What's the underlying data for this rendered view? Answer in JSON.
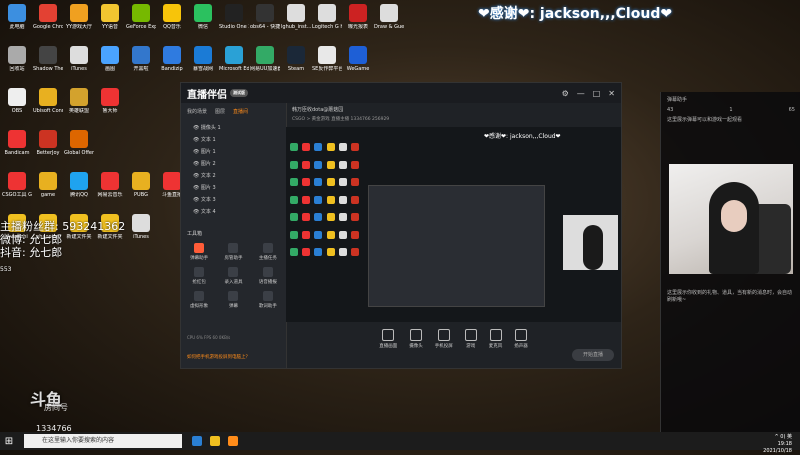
{
  "top_banner": "❤感谢❤: jackson,,,Cloud❤",
  "desktop": {
    "icons": [
      {
        "label": "此电脑",
        "color": "#3c8fe0"
      },
      {
        "label": "Google Chrome",
        "color": "#e34133"
      },
      {
        "label": "YY游戏大厅",
        "color": "#f0a020"
      },
      {
        "label": "YY语音",
        "color": "#f2c530"
      },
      {
        "label": "GeForce Experience",
        "color": "#76b900"
      },
      {
        "label": "QQ音乐",
        "color": "#f7c40a"
      },
      {
        "label": "微信",
        "color": "#2bc15f"
      },
      {
        "label": "Studio One 3",
        "color": "#222"
      },
      {
        "label": "obs64 - 快捷方式",
        "color": "#333"
      },
      {
        "label": "lghub_inst...",
        "color": "#ddd"
      },
      {
        "label": "Logitech G HUB",
        "color": "#ddd"
      },
      {
        "label": "曝光报表",
        "color": "#c22"
      },
      {
        "label": "Draw & Guess",
        "color": "#ddd"
      },
      {
        "label": "回收站",
        "color": "#aaa"
      },
      {
        "label": "Shadow The Wine Sour...",
        "color": "#444"
      },
      {
        "label": "iTunes",
        "color": "#ddd"
      },
      {
        "label": "画图",
        "color": "#4aa3ff"
      },
      {
        "label": "开黑啦",
        "color": "#37c"
      },
      {
        "label": "Bandizip",
        "color": "#2f7be0"
      },
      {
        "label": "暴雪战网",
        "color": "#1b7bd6"
      },
      {
        "label": "Microsoft Edge",
        "color": "#2aa1d6"
      },
      {
        "label": "网易UU加速器",
        "color": "#3a6"
      },
      {
        "label": "Steam",
        "color": "#1b2838"
      },
      {
        "label": "SE反作弊平台",
        "color": "#e8e8e8"
      },
      {
        "label": "WeGame",
        "color": "#1e5fd6"
      },
      {
        "label": "OBS",
        "color": "#eee"
      },
      {
        "label": "Ubisoft Connect",
        "color": "#e8b020"
      },
      {
        "label": "英雄联盟",
        "color": "#d3a22d"
      },
      {
        "label": "鲁大师",
        "color": "#e33"
      },
      {
        "label": "Bandicam",
        "color": "#e33"
      },
      {
        "label": "BetterJoy",
        "color": "#c32"
      },
      {
        "label": "Global Offensive",
        "color": "#d60"
      },
      {
        "label": "CSGO工具 Gamemode",
        "color": "#e33"
      },
      {
        "label": "game",
        "color": "#e8b020"
      },
      {
        "label": "腾讯QQ",
        "color": "#1fa3ef"
      },
      {
        "label": "网易云音乐",
        "color": "#e33"
      },
      {
        "label": "PUBG",
        "color": "#e8b020"
      },
      {
        "label": "斗鱼直播",
        "color": "#e33"
      },
      {
        "label": "wwenzhi",
        "color": "#f0c020"
      },
      {
        "label": "shaopian",
        "color": "#f0c020"
      },
      {
        "label": "新建文件夹",
        "color": "#f0c020"
      },
      {
        "label": "新建文件夹",
        "color": "#f0c020"
      },
      {
        "label": "iTunes",
        "color": "#ddd"
      }
    ]
  },
  "overlay": {
    "fan_group": "主播粉丝群: 593241362",
    "weibo": "微博: 允七郎",
    "douyin": "抖音: 允七郎",
    "count": "553"
  },
  "douyu_logo": {
    "brand": "斗鱼",
    "sub": "房间号",
    "room_id": "1334766"
  },
  "app": {
    "name": "直播伴侣",
    "version_badge": "测试版",
    "sidebar_tabs": [
      "我的场景",
      "图层",
      "直播间"
    ],
    "scenes": [
      "摄像头 1",
      "文本 1",
      "图片 1",
      "图片 2",
      "文本 2",
      "图片 3",
      "文本 3",
      "文本 4"
    ],
    "tools_title": "工具箱",
    "tools": [
      {
        "label": "弹幕助手",
        "hl": true
      },
      {
        "label": "房管助手",
        "hl": false
      },
      {
        "label": "主播任务",
        "hl": false
      },
      {
        "label": "抢红包",
        "hl": false
      },
      {
        "label": "录入道具",
        "hl": false
      },
      {
        "label": "语音播报",
        "hl": false
      },
      {
        "label": "虚拟形象",
        "hl": false
      },
      {
        "label": "弹幕",
        "hl": false
      },
      {
        "label": "歌词助手",
        "hl": false
      }
    ],
    "sidebar_footer": "如何把手机游戏投屏到电脑上？",
    "room_title": "韩万臣收dota@蘑菇园",
    "room_meta": "CSGO > 黄金游戏    直播主播    1334766    256929",
    "preview_banner": "❤感谢❤: jackson,,,Cloud❤",
    "toolbar": [
      {
        "label": "直播画面"
      },
      {
        "label": "摄像头"
      },
      {
        "label": "手机投屏"
      },
      {
        "label": "游戏"
      },
      {
        "label": "麦克风"
      },
      {
        "label": "扬声器"
      }
    ],
    "go_live": "开始直播",
    "status": "CPU 6%    FPS 60    0KB/s"
  },
  "right_panel": {
    "header": "弹幕助手",
    "stats": [
      "43",
      "1",
      "65"
    ],
    "notice": "这里展示弹幕可以和游戏一起观看",
    "bottom_notice": "这里展示你收到的礼物、道具，当有新的消息时，会自动刷新哦~"
  },
  "taskbar": {
    "search_placeholder": "在这里输入你要搜索的内容",
    "time": "19:18",
    "date": "2021/10/18",
    "tray": "^ 0) 英"
  }
}
